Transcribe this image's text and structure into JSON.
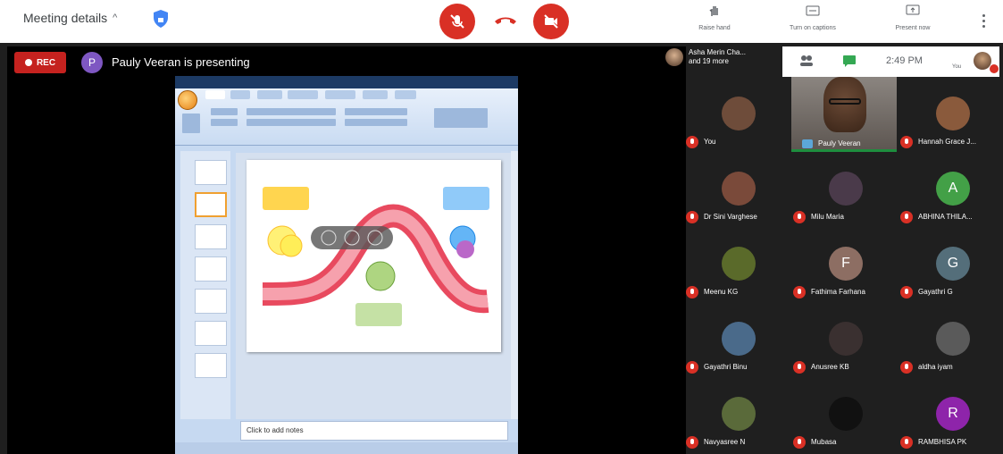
{
  "topbar": {
    "meeting_details": "Meeting details",
    "tools": [
      {
        "label": "Raise hand",
        "icon": "hand-icon"
      },
      {
        "label": "Turn on captions",
        "icon": "captions-icon"
      },
      {
        "label": "Present now",
        "icon": "present-icon"
      }
    ]
  },
  "stage": {
    "rec_label": "REC",
    "presenter_initial": "P",
    "presenter_text": "Pauly Veeran is presenting",
    "notes_placeholder": "Click to add notes"
  },
  "self_bar": {
    "clock": "2:49 PM",
    "you_label": "You"
  },
  "others_label_1": "Asha Merin Cha...",
  "others_label_2": "and 19 more",
  "speaker": {
    "name": "Pauly Veeran"
  },
  "participants": [
    {
      "name": "You",
      "initial": "",
      "color": "#6e4c3a"
    },
    {
      "name": "Hannah Grace J...",
      "initial": "",
      "color": "#8a5a3c"
    },
    {
      "name": "Dr Sini Varghese",
      "initial": "",
      "color": "#7a4a3a"
    },
    {
      "name": "Milu Maria",
      "initial": "",
      "color": "#4a3a4a"
    },
    {
      "name": "ABHINA THILA...",
      "initial": "A",
      "color": "#43a047"
    },
    {
      "name": "Meenu KG",
      "initial": "",
      "color": "#5a6a2a"
    },
    {
      "name": "Fathima Farhana",
      "initial": "F",
      "color": "#8d6e63"
    },
    {
      "name": "Gayathri G",
      "initial": "G",
      "color": "#546e7a"
    },
    {
      "name": "Gayathri Binu",
      "initial": "",
      "color": "#4a6a8a"
    },
    {
      "name": "Anusree KB",
      "initial": "",
      "color": "#3a3030"
    },
    {
      "name": "aldha iyam",
      "initial": "",
      "color": "#5a5a5a"
    },
    {
      "name": "Navyasree N",
      "initial": "",
      "color": "#5a6a3a"
    },
    {
      "name": "Mubasa",
      "initial": "",
      "color": "#111111"
    },
    {
      "name": "RAMBHISA PK",
      "initial": "R",
      "color": "#8e24aa"
    }
  ]
}
